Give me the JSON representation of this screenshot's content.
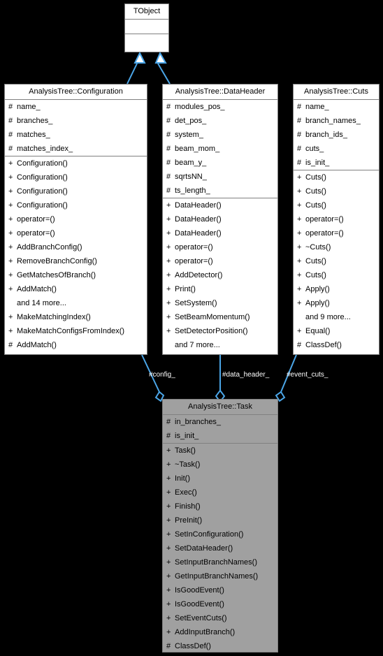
{
  "diagram": {
    "type": "uml-class-diagram",
    "background_color": "#000000",
    "box_fill": "#ffffff",
    "box_border": "#808080",
    "shaded_fill": "#a0a0a0",
    "edge_color": "#4ba6e8",
    "label_color": "#ffffff"
  },
  "classes": {
    "tobject": {
      "name": "TObject",
      "attributes": [],
      "methods": []
    },
    "configuration": {
      "name": "AnalysisTree::Configuration",
      "attributes": [
        {
          "vis": "#",
          "label": "name_"
        },
        {
          "vis": "#",
          "label": "branches_"
        },
        {
          "vis": "#",
          "label": "matches_"
        },
        {
          "vis": "#",
          "label": "matches_index_"
        }
      ],
      "methods": [
        {
          "vis": "+",
          "label": "Configuration()"
        },
        {
          "vis": "+",
          "label": "Configuration()"
        },
        {
          "vis": "+",
          "label": "Configuration()"
        },
        {
          "vis": "+",
          "label": "Configuration()"
        },
        {
          "vis": "+",
          "label": "operator=()"
        },
        {
          "vis": "+",
          "label": "operator=()"
        },
        {
          "vis": "+",
          "label": "AddBranchConfig()"
        },
        {
          "vis": "+",
          "label": "RemoveBranchConfig()"
        },
        {
          "vis": "+",
          "label": "GetMatchesOfBranch()"
        },
        {
          "vis": "+",
          "label": "AddMatch()"
        },
        {
          "vis": "",
          "label": "and 14 more..."
        },
        {
          "vis": "+",
          "label": "MakeMatchingIndex()"
        },
        {
          "vis": "+",
          "label": "MakeMatchConfigsFromIndex()"
        },
        {
          "vis": "#",
          "label": "AddMatch()"
        }
      ]
    },
    "dataheader": {
      "name": "AnalysisTree::DataHeader",
      "attributes": [
        {
          "vis": "#",
          "label": "modules_pos_"
        },
        {
          "vis": "#",
          "label": "det_pos_"
        },
        {
          "vis": "#",
          "label": "system_"
        },
        {
          "vis": "#",
          "label": "beam_mom_"
        },
        {
          "vis": "#",
          "label": "beam_y_"
        },
        {
          "vis": "#",
          "label": "sqrtsNN_"
        },
        {
          "vis": "#",
          "label": "ts_length_"
        }
      ],
      "methods": [
        {
          "vis": "+",
          "label": "DataHeader()"
        },
        {
          "vis": "+",
          "label": "DataHeader()"
        },
        {
          "vis": "+",
          "label": "DataHeader()"
        },
        {
          "vis": "+",
          "label": "operator=()"
        },
        {
          "vis": "+",
          "label": "operator=()"
        },
        {
          "vis": "+",
          "label": "AddDetector()"
        },
        {
          "vis": "+",
          "label": "Print()"
        },
        {
          "vis": "+",
          "label": "SetSystem()"
        },
        {
          "vis": "+",
          "label": "SetBeamMomentum()"
        },
        {
          "vis": "+",
          "label": "SetDetectorPosition()"
        },
        {
          "vis": "",
          "label": "and 7 more..."
        }
      ]
    },
    "cuts": {
      "name": "AnalysisTree::Cuts",
      "attributes": [
        {
          "vis": "#",
          "label": "name_"
        },
        {
          "vis": "#",
          "label": "branch_names_"
        },
        {
          "vis": "#",
          "label": "branch_ids_"
        },
        {
          "vis": "#",
          "label": "cuts_"
        },
        {
          "vis": "#",
          "label": "is_init_"
        }
      ],
      "methods": [
        {
          "vis": "+",
          "label": "Cuts()"
        },
        {
          "vis": "+",
          "label": "Cuts()"
        },
        {
          "vis": "+",
          "label": "Cuts()"
        },
        {
          "vis": "+",
          "label": "operator=()"
        },
        {
          "vis": "+",
          "label": "operator=()"
        },
        {
          "vis": "+",
          "label": "~Cuts()"
        },
        {
          "vis": "+",
          "label": "Cuts()"
        },
        {
          "vis": "+",
          "label": "Cuts()"
        },
        {
          "vis": "+",
          "label": "Apply()"
        },
        {
          "vis": "+",
          "label": "Apply()"
        },
        {
          "vis": "",
          "label": "and 9 more..."
        },
        {
          "vis": "+",
          "label": "Equal()"
        },
        {
          "vis": "#",
          "label": "ClassDef()"
        }
      ]
    },
    "task": {
      "name": "AnalysisTree::Task",
      "attributes": [
        {
          "vis": "#",
          "label": "in_branches_"
        },
        {
          "vis": "#",
          "label": "is_init_"
        }
      ],
      "methods": [
        {
          "vis": "+",
          "label": "Task()"
        },
        {
          "vis": "+",
          "label": "~Task()"
        },
        {
          "vis": "+",
          "label": "Init()"
        },
        {
          "vis": "+",
          "label": "Exec()"
        },
        {
          "vis": "+",
          "label": "Finish()"
        },
        {
          "vis": "+",
          "label": "PreInit()"
        },
        {
          "vis": "+",
          "label": "SetInConfiguration()"
        },
        {
          "vis": "+",
          "label": "SetDataHeader()"
        },
        {
          "vis": "+",
          "label": "SetInputBranchNames()"
        },
        {
          "vis": "+",
          "label": "GetInputBranchNames()"
        },
        {
          "vis": "+",
          "label": "IsGoodEvent()"
        },
        {
          "vis": "+",
          "label": "IsGoodEvent()"
        },
        {
          "vis": "+",
          "label": "SetEventCuts()"
        },
        {
          "vis": "+",
          "label": "AddInputBranch()"
        },
        {
          "vis": "#",
          "label": "ClassDef()"
        }
      ]
    }
  },
  "edge_labels": {
    "config": "#config_",
    "data_header": "#data_header_",
    "event_cuts": "#event_cuts_"
  }
}
